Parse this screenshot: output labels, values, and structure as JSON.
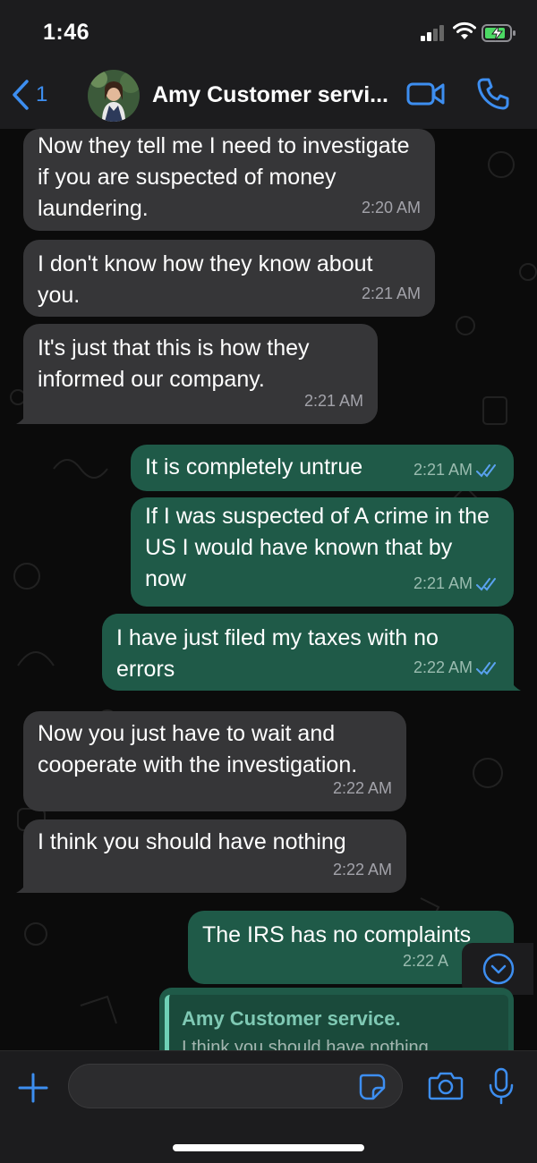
{
  "status": {
    "time": "1:46"
  },
  "header": {
    "back_count": "1",
    "contact_name": "Amy Customer servi..."
  },
  "messages": [
    {
      "dir": "in",
      "text": "Now they tell me I need to investigate if you are suspected of money laundering.",
      "time": "2:20 AM"
    },
    {
      "dir": "in",
      "text": "I don't know how they know about you.",
      "time": "2:21 AM"
    },
    {
      "dir": "in",
      "text": "It's just that this is how they informed our company.",
      "time": "2:21 AM"
    },
    {
      "dir": "out",
      "text": "It is completely untrue",
      "time": "2:21 AM",
      "read": true
    },
    {
      "dir": "out",
      "text": "If I was suspected of A crime in the US I would have known that by now",
      "time": "2:21 AM",
      "read": true
    },
    {
      "dir": "out",
      "text": "I have just filed my taxes with no errors",
      "time": "2:22 AM",
      "read": true
    },
    {
      "dir": "in",
      "text": "Now you just have to wait and cooperate with the investigation.",
      "time": "2:22 AM"
    },
    {
      "dir": "in",
      "text": "I think you should have nothing",
      "time": "2:22 AM"
    },
    {
      "dir": "out",
      "text": "The IRS has no complaints",
      "time": "2:22 A",
      "read": true
    }
  ],
  "reply_preview": {
    "name": "Amy Customer service.",
    "text": "I think you should have nothing"
  },
  "composer": {
    "placeholder": ""
  },
  "colors": {
    "accent": "#3d8ef0",
    "incoming": "#363638",
    "outgoing": "#1f5a48",
    "read_ticks": "#5aa2f0"
  },
  "icons": [
    "back-chevron-icon",
    "video-call-icon",
    "phone-icon",
    "chevron-down-icon",
    "plus-icon",
    "sticker-icon",
    "camera-icon",
    "microphone-icon",
    "double-check-icon"
  ]
}
